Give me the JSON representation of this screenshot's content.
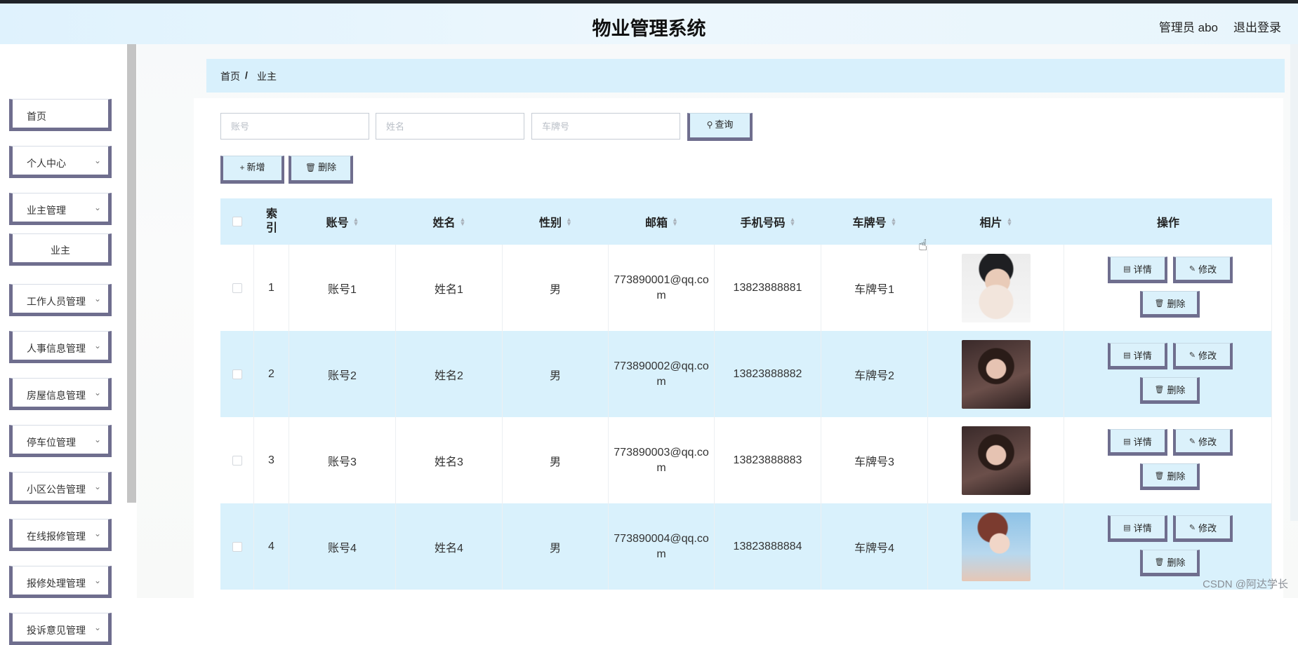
{
  "header": {
    "title": "物业管理系统",
    "user": "管理员 abo",
    "logout": "退出登录"
  },
  "sidebar": {
    "items": [
      {
        "label": "首页",
        "has_chevron": false
      },
      {
        "label": "个人中心",
        "has_chevron": true
      },
      {
        "label": "业主管理",
        "has_chevron": true
      },
      {
        "label": "业主",
        "has_chevron": false,
        "sub": true
      },
      {
        "label": "工作人员管理",
        "has_chevron": true
      },
      {
        "label": "人事信息管理",
        "has_chevron": true
      },
      {
        "label": "房屋信息管理",
        "has_chevron": true
      },
      {
        "label": "停车位管理",
        "has_chevron": true
      },
      {
        "label": "小区公告管理",
        "has_chevron": true
      },
      {
        "label": "在线报修管理",
        "has_chevron": true
      },
      {
        "label": "报修处理管理",
        "has_chevron": true
      },
      {
        "label": "投诉意见管理",
        "has_chevron": true
      }
    ]
  },
  "breadcrumb": {
    "home": "首页",
    "separator": "/",
    "current": "业主"
  },
  "search": {
    "account_placeholder": "账号",
    "name_placeholder": "姓名",
    "plate_placeholder": "车牌号",
    "query_label": "查询"
  },
  "toolbar": {
    "add_label": "新增",
    "delete_label": "删除"
  },
  "table": {
    "headers": {
      "index": "索引",
      "account": "账号",
      "name": "姓名",
      "gender": "性别",
      "email": "邮箱",
      "phone": "手机号码",
      "plate": "车牌号",
      "photo": "相片",
      "actions": "操作"
    },
    "rows": [
      {
        "index": "1",
        "account": "账号1",
        "name": "姓名1",
        "gender": "男",
        "email": "773890001@qq.com",
        "phone": "13823888881",
        "plate": "车牌号1"
      },
      {
        "index": "2",
        "account": "账号2",
        "name": "姓名2",
        "gender": "男",
        "email": "773890002@qq.com",
        "phone": "13823888882",
        "plate": "车牌号2"
      },
      {
        "index": "3",
        "account": "账号3",
        "name": "姓名3",
        "gender": "男",
        "email": "773890003@qq.com",
        "phone": "13823888883",
        "plate": "车牌号3"
      },
      {
        "index": "4",
        "account": "账号4",
        "name": "姓名4",
        "gender": "男",
        "email": "773890004@qq.com",
        "phone": "13823888884",
        "plate": "车牌号4"
      }
    ],
    "row_actions": {
      "detail": "详情",
      "edit": "修改",
      "delete": "删除"
    }
  },
  "icons": {
    "query": "search-icon",
    "add": "plus-icon",
    "delete": "trash-icon",
    "detail": "document-icon",
    "edit": "pencil-icon",
    "sort": "sort-caret-icon",
    "nav_chevron": "chevron-down-icon"
  },
  "colors": {
    "accent_light_blue": "#d8f0fc",
    "button_border": "#6f6e8e",
    "header_bg": "#dff2fd"
  },
  "watermark": "CSDN @阿达学长"
}
